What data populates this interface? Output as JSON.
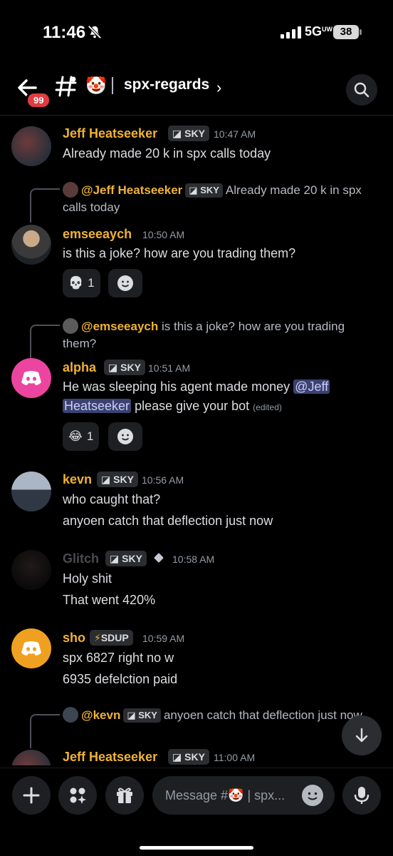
{
  "status": {
    "time": "11:46",
    "network": "5G",
    "network_sub": "UW",
    "battery": "38"
  },
  "header": {
    "unread_badge": "99",
    "channel_emoji": "🤡",
    "channel_name": "spx-regards",
    "chevron": "›"
  },
  "messages": [
    {
      "author": "Jeff Heatseeker",
      "tag": "SKY",
      "time": "10:47 AM",
      "lines": [
        "Already made 20 k in spx calls today"
      ]
    },
    {
      "reply": {
        "name": "@Jeff Heatseeker",
        "tag": "SKY",
        "text": "Already made 20 k in spx calls today"
      },
      "author": "emseeaych",
      "time": "10:50 AM",
      "lines": [
        "is this a joke? how are you trading them?"
      ],
      "reaction": {
        "emoji": "💀",
        "count": "1"
      }
    },
    {
      "reply": {
        "name": "@emseeaych",
        "text": "is this a joke? how are you trading them?"
      },
      "author": "alpha",
      "tag": "SKY",
      "time": "10:51 AM",
      "line1_pre": "He was sleeping his agent made money ",
      "mention_part1": "@Jeff",
      "mention_part2": "Heatseeker",
      "line2_post": " please give your bot ",
      "edited": "(edited)",
      "reaction": {
        "emoji": "😂",
        "count": "1"
      }
    },
    {
      "author": "kevn",
      "tag": "SKY",
      "time": "10:56 AM",
      "lines": [
        "who caught that?",
        "anyoen catch that deflection just now"
      ]
    },
    {
      "author": "Glitch",
      "tag": "SKY",
      "time": "10:58 AM",
      "lines": [
        "Holy shit",
        "That went 420%"
      ]
    },
    {
      "author": "sho",
      "tag": "SDUP",
      "time": "10:59 AM",
      "lines": [
        "spx 6827 right no w",
        "6935 defelction paid"
      ]
    },
    {
      "reply": {
        "name": "@kevn",
        "tag": "SKY",
        "text": "anyoen catch that deflection just now"
      },
      "author": "Jeff Heatseeker",
      "tag": "SKY",
      "time": "11:00 AM"
    }
  ],
  "composer": {
    "placeholder": "Message #🤡 | spx..."
  },
  "colors": {
    "background": "#000000",
    "author": "#f0b232",
    "mention_bg": "#3c4270",
    "discord_pink": "#eb459f",
    "discord_yellow": "#f0a020",
    "badge_red": "#e23b41"
  }
}
